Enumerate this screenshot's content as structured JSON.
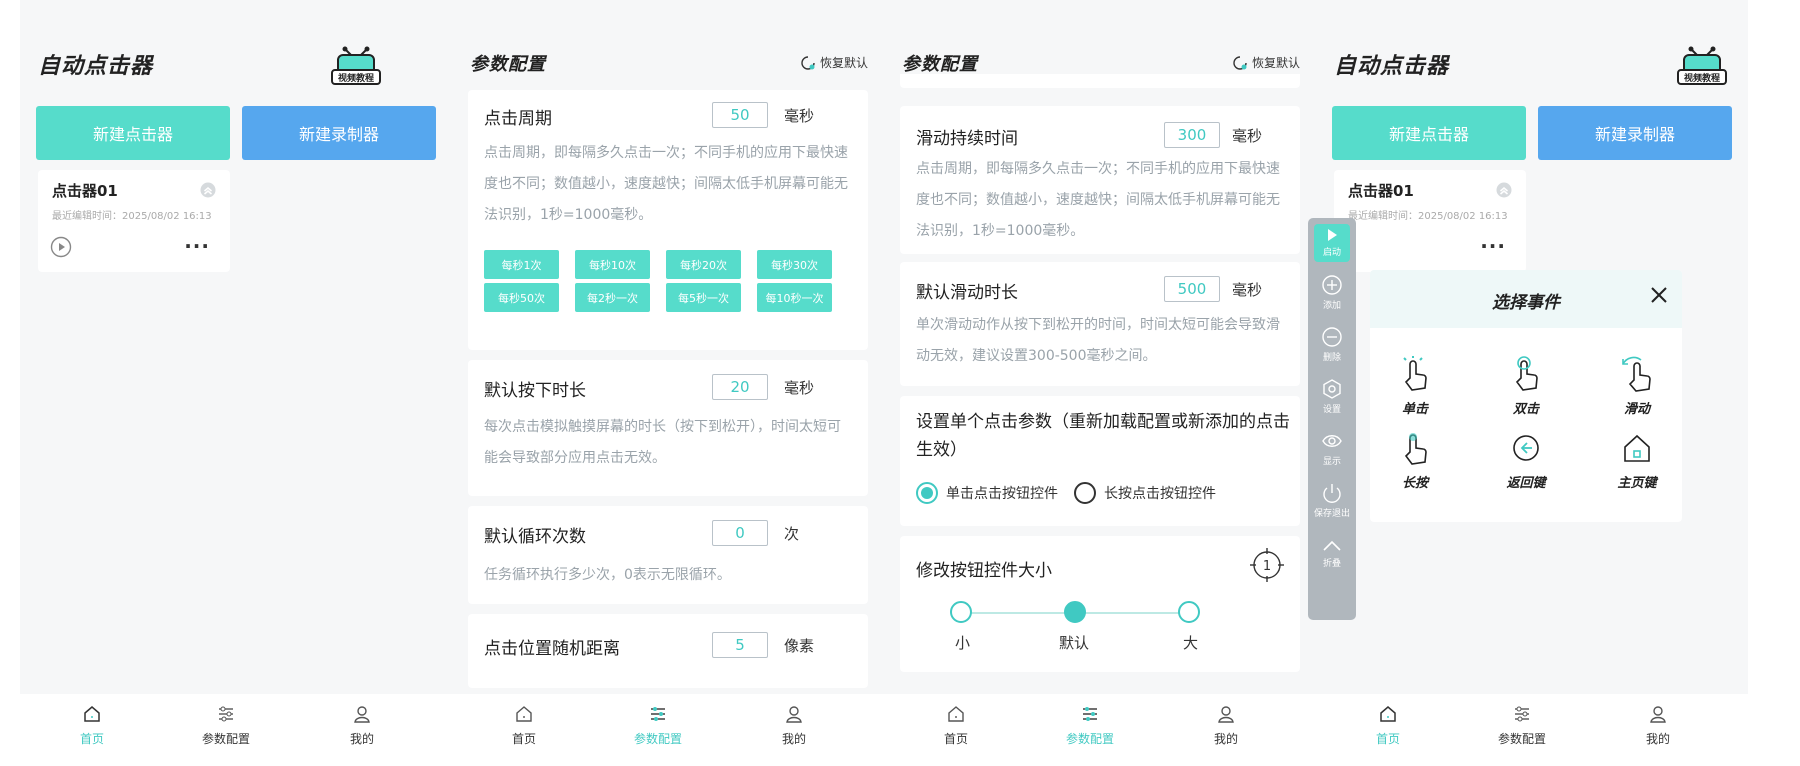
{
  "screens": [
    {
      "title": "自动点击器",
      "logo_text": "视频教程",
      "buttons": {
        "new_clicker": "新建点击器",
        "new_recorder": "新建录制器"
      },
      "clicker": {
        "name": "点击器01",
        "time": "最近编辑时间：2025/08/02 16:13",
        "more": "···"
      }
    },
    {
      "title": "参数配置",
      "restore": "恢复默认",
      "click_period": {
        "title": "点击周期",
        "value": "50",
        "unit": "毫秒",
        "desc": "点击周期，即每隔多久点击一次；不同手机的应用下最快速度也不同；数值越小，速度越快；间隔太低手机屏幕可能无法识别，1秒=1000毫秒。",
        "chips": [
          "每秒1次",
          "每秒10次",
          "每秒20次",
          "每秒30次",
          "每秒50次",
          "每2秒一次",
          "每5秒一次",
          "每10秒一次"
        ]
      },
      "press_duration": {
        "title": "默认按下时长",
        "value": "20",
        "unit": "毫秒",
        "desc": "每次点击模拟触摸屏幕的时长（按下到松开），时间太短可能会导致部分应用点击无效。"
      },
      "loop_count": {
        "title": "默认循环次数",
        "value": "0",
        "unit": "次",
        "desc": "任务循环执行多少次，0表示无限循环。"
      },
      "random_distance": {
        "title": "点击位置随机距离",
        "value": "5",
        "unit": "像素"
      }
    },
    {
      "title": "参数配置",
      "restore": "恢复默认",
      "swipe_duration": {
        "title": "滑动持续时间",
        "value": "300",
        "unit": "毫秒",
        "desc": "点击周期，即每隔多久点击一次；不同手机的应用下最快速度也不同；数值越小，速度越快；间隔太低手机屏幕可能无法识别，1秒=1000毫秒。"
      },
      "default_swipe": {
        "title": "默认滑动时长",
        "value": "500",
        "unit": "毫秒",
        "desc": "单次滑动动作从按下到松开的时间，时间太短可能会导致滑动无效，建议设置300-500毫秒之间。"
      },
      "single_click": {
        "title": "设置单个点击参数（重新加载配置或新添加的点击生效）",
        "option_a": "单击点击按钮控件",
        "option_b": "长按点击按钮控件",
        "selected": "option_a"
      },
      "button_size": {
        "title": "修改按钮控件大小",
        "badge": "1",
        "labels": [
          "小",
          "默认",
          "大"
        ],
        "selected_index": 1
      }
    },
    {
      "title": "自动点击器",
      "logo_text": "视频教程",
      "buttons": {
        "new_clicker": "新建点击器",
        "new_recorder": "新建录制器"
      },
      "clicker": {
        "name": "点击器01",
        "time": "最近编辑时间：2025/08/02 16:13",
        "more": "···"
      },
      "float_bar": [
        "启动",
        "添加",
        "删除",
        "设置",
        "显示",
        "保存退出",
        "折叠"
      ],
      "event_panel": {
        "title": "选择事件",
        "events": [
          "单击",
          "双击",
          "滑动",
          "长按",
          "返回键",
          "主页键"
        ]
      }
    }
  ],
  "tabs": [
    "首页",
    "参数配置",
    "我的"
  ],
  "colors": {
    "teal": "#56dccb",
    "blue": "#56a7ee",
    "accent": "#40c9c2",
    "gray_text": "#9aa3aa"
  }
}
